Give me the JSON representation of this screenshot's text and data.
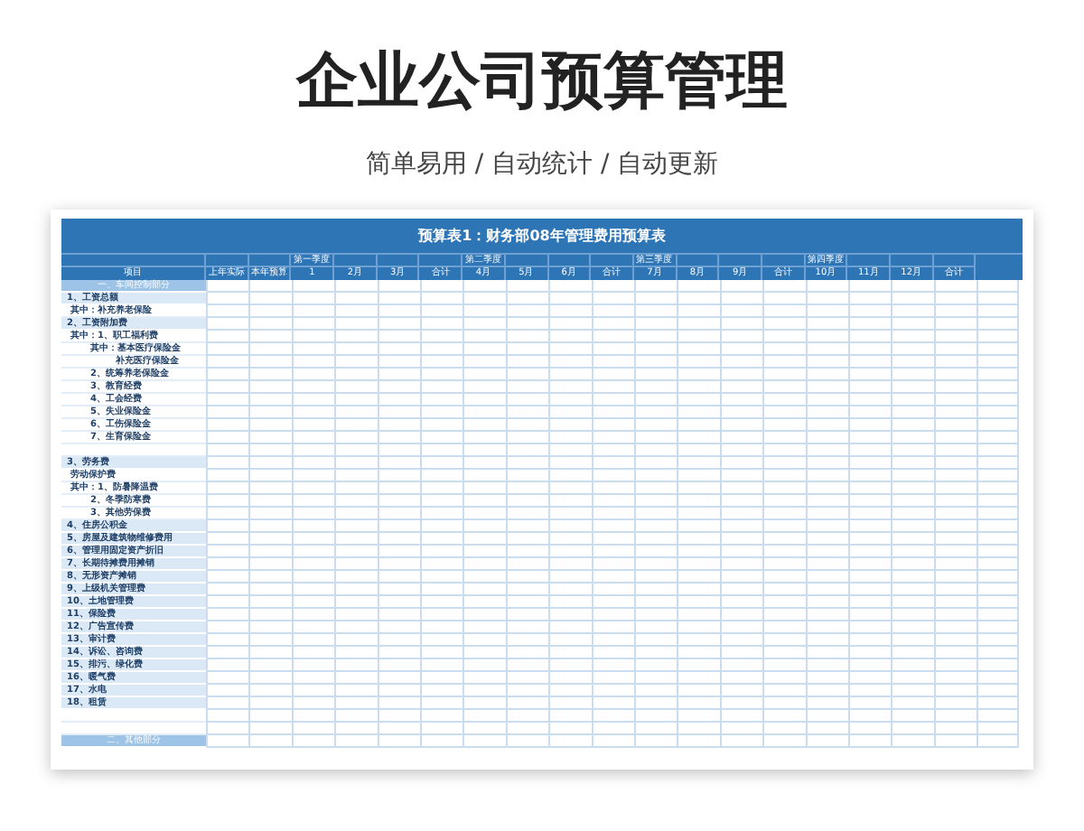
{
  "page": {
    "title": "企业公司预算管理",
    "subtitle": "简单易用 / 自动统计 / 自动更新"
  },
  "table": {
    "title": "预算表1：财务部08年管理费用预算表",
    "quarters": [
      {
        "label": "第一季度"
      },
      {
        "label": "第二季度"
      },
      {
        "label": "第三季度"
      },
      {
        "label": "第四季度"
      }
    ],
    "columns": [
      {
        "label": "项目"
      },
      {
        "label": "上年实际"
      },
      {
        "label": "本年预算"
      },
      {
        "label": "1"
      },
      {
        "label": "2月"
      },
      {
        "label": "3月"
      },
      {
        "label": "合计"
      },
      {
        "label": "4月"
      },
      {
        "label": "5月"
      },
      {
        "label": "6月"
      },
      {
        "label": "合计"
      },
      {
        "label": "7月"
      },
      {
        "label": "8月"
      },
      {
        "label": "9月"
      },
      {
        "label": "合计"
      },
      {
        "label": "10月"
      },
      {
        "label": "11月"
      },
      {
        "label": "12月"
      },
      {
        "label": "合计"
      }
    ],
    "rows": [
      {
        "kind": "section",
        "label": "一、车间控制部分"
      },
      {
        "kind": "group",
        "label": "1、工资总额"
      },
      {
        "kind": "item",
        "label": "其中：补充养老保险"
      },
      {
        "kind": "group",
        "label": "2、工资附加费"
      },
      {
        "kind": "item",
        "label": "其中：1、职工福利费"
      },
      {
        "kind": "sub",
        "label": "其中：基本医疗保险金"
      },
      {
        "kind": "subsub",
        "label": "补充医疗保险金"
      },
      {
        "kind": "sub",
        "label": "2、统筹养老保险金"
      },
      {
        "kind": "sub",
        "label": "3、教育经费"
      },
      {
        "kind": "sub",
        "label": "4、工会经费"
      },
      {
        "kind": "sub",
        "label": "5、失业保险金"
      },
      {
        "kind": "sub",
        "label": "6、工伤保险金"
      },
      {
        "kind": "sub",
        "label": "7、生育保险金"
      },
      {
        "kind": "blank"
      },
      {
        "kind": "group",
        "label": "3、劳务费"
      },
      {
        "kind": "item",
        "label": "劳动保护费"
      },
      {
        "kind": "item",
        "label": "其中：1、防暑降温费"
      },
      {
        "kind": "sub",
        "label": "2、冬季防寒费"
      },
      {
        "kind": "sub",
        "label": "3、其他劳保费"
      },
      {
        "kind": "group",
        "label": "4、住房公积金"
      },
      {
        "kind": "group",
        "label": "5、房屋及建筑物维修费用"
      },
      {
        "kind": "group",
        "label": "6、管理用固定资产折旧"
      },
      {
        "kind": "group",
        "label": "7、长期待摊费用摊销"
      },
      {
        "kind": "group",
        "label": "8、无形资产摊销"
      },
      {
        "kind": "group",
        "label": "9、上级机关管理费"
      },
      {
        "kind": "group",
        "label": "10、土地管理费"
      },
      {
        "kind": "group",
        "label": "11、保险费"
      },
      {
        "kind": "group",
        "label": "12、广告宣传费"
      },
      {
        "kind": "group",
        "label": "13、审计费"
      },
      {
        "kind": "group",
        "label": "14、诉讼、咨询费"
      },
      {
        "kind": "group",
        "label": "15、排污、绿化费"
      },
      {
        "kind": "group",
        "label": "16、暖气费"
      },
      {
        "kind": "group",
        "label": "17、水电"
      },
      {
        "kind": "group",
        "label": "18、租赁"
      },
      {
        "kind": "blank"
      },
      {
        "kind": "blank"
      },
      {
        "kind": "section",
        "label": "二、其他部分"
      }
    ]
  }
}
